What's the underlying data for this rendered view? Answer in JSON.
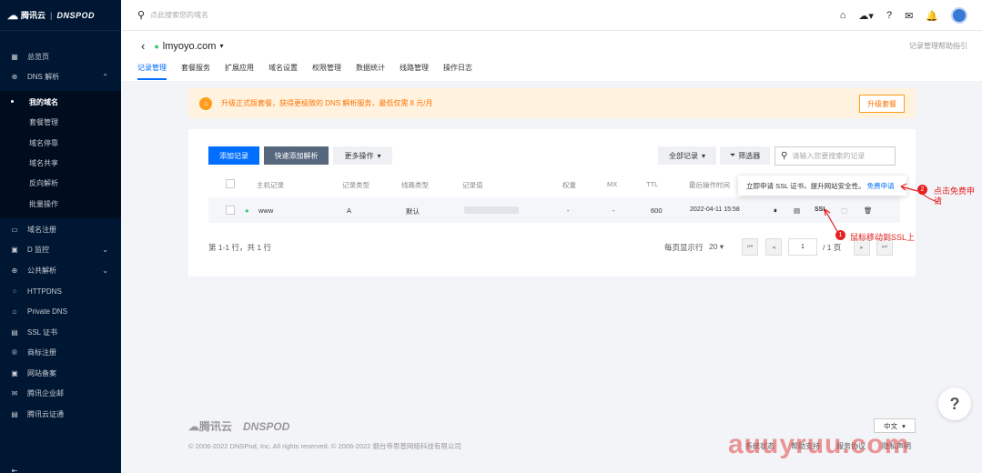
{
  "brand": {
    "cloud_name": "腾讯云",
    "dnspod": "DNSPOD"
  },
  "sidebar": {
    "items": [
      {
        "label": "总览页",
        "icon": "grid-icon"
      },
      {
        "label": "DNS 解析",
        "icon": "globe-icon",
        "expanded": true
      },
      {
        "label": "我的域名",
        "active": true
      },
      {
        "label": "套餐管理"
      },
      {
        "label": "域名停靠"
      },
      {
        "label": "域名共享"
      },
      {
        "label": "反向解析"
      },
      {
        "label": "批量操作"
      },
      {
        "label": "域名注册",
        "icon": "calendar-icon"
      },
      {
        "label": "D 监控",
        "icon": "monitor-icon"
      },
      {
        "label": "公共解析",
        "icon": "globe-icon"
      },
      {
        "label": "HTTPDNS",
        "icon": "network-icon"
      },
      {
        "label": "Private DNS",
        "icon": "lock-icon"
      },
      {
        "label": "SSL 证书",
        "icon": "certificate-icon"
      },
      {
        "label": "商标注册",
        "icon": "trademark-icon"
      },
      {
        "label": "网站备案",
        "icon": "record-icon"
      },
      {
        "label": "腾讯企业邮",
        "icon": "mail-icon"
      },
      {
        "label": "腾讯云证通",
        "icon": "id-card-icon"
      }
    ]
  },
  "topbar": {
    "search_placeholder": "点此搜索您的域名"
  },
  "header": {
    "domain": "lmyoyo.com",
    "help_link": "记录管理帮助指引",
    "tabs": [
      "记录管理",
      "套餐服务",
      "扩展应用",
      "域名设置",
      "权限管理",
      "数据统计",
      "线路管理",
      "操作日志"
    ]
  },
  "banner": {
    "text": "升级正式版套餐，获得更极致的 DNS 解析服务，最低仅需 8 元/月",
    "button": "升级套餐"
  },
  "toolbar": {
    "add": "添加记录",
    "quick_add": "快速添加解析",
    "more": "更多操作",
    "all_records": "全部记录",
    "filter": "筛选器",
    "search_placeholder": "请输入您要搜索的记录"
  },
  "table": {
    "headers": [
      "主机记录",
      "记录类型",
      "线路类型",
      "记录值",
      "权重",
      "MX",
      "TTL",
      "最后操作时间"
    ],
    "row": {
      "host": "www",
      "type": "A",
      "line": "默认",
      "weight": "-",
      "mx": "-",
      "ttl": "600",
      "time": "2022-04-11 15:58",
      "ssl": "SSL"
    }
  },
  "pager": {
    "summary": "第 1-1 行，共 1 行",
    "per_page_label": "每页显示行",
    "per_page": "20",
    "page": "1",
    "total_pages": "/ 1 页"
  },
  "tooltip": {
    "text": "立即申请 SSL 证书，提升网站安全性。",
    "link": "免费申请"
  },
  "annotations": {
    "a1": "鼠标移动到SSL上",
    "a2_line1": "点击免费申",
    "a2_line2": "请",
    "n1": "1",
    "n2": "2"
  },
  "footer": {
    "copyright": "© 2006-2022 DNSPod, Inc. All rights reserved. © 2006-2022 烟台帝思普网络科技有限公司",
    "links": [
      "系统状态",
      "帮助支持",
      "服务协议",
      "隐私声明"
    ],
    "lang": "中文"
  },
  "help": "?",
  "watermark": "auuyruu.com",
  "colors": {
    "sidebar": "#001733",
    "accent": "#006eff",
    "warning": "#ff7200",
    "annotation": "#e52020"
  }
}
